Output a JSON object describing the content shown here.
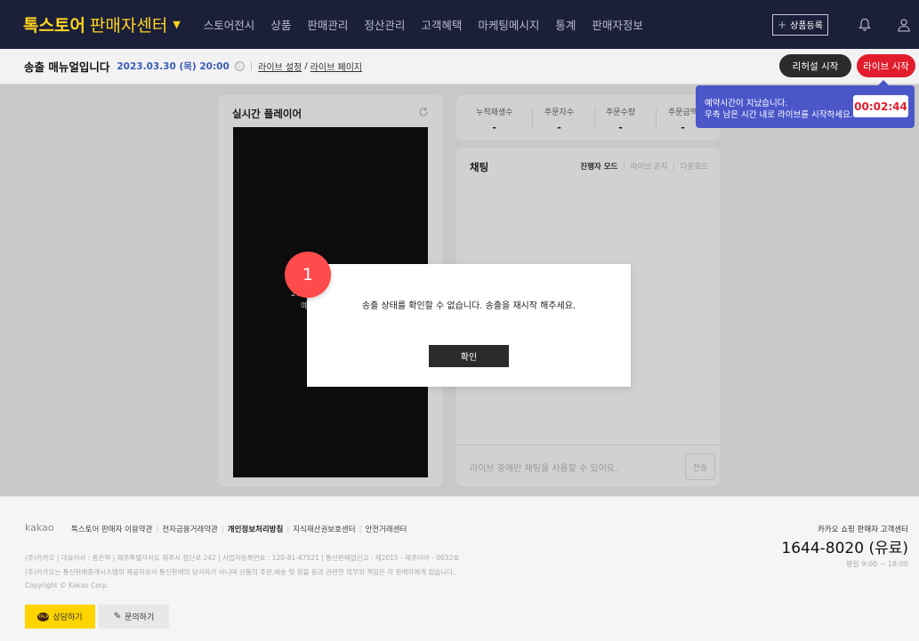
{
  "nav": {
    "brand_main": "톡스토어",
    "brand_sub": "판매자센터",
    "brand_caret": "▼",
    "menu": [
      "스토어전시",
      "상품",
      "판매관리",
      "정산관리",
      "고객혜택",
      "마케팅메시지",
      "통계",
      "판매자정보"
    ],
    "register_label": "상품등록",
    "register_icon": "plus-icon",
    "icons": [
      "bell-icon",
      "user-icon"
    ]
  },
  "subheader": {
    "title": "송출 매뉴얼입니다",
    "date": "2023.03.30 (목) 20:00",
    "info_icon": "ⓘ",
    "link_settings": "라이브 설정",
    "slash": "/",
    "link_page": "라이브 페이지",
    "rehearsal_button": "리허설 시작",
    "live_button": "라이브 시작"
  },
  "player": {
    "title": "실시간 플레이어",
    "refresh_icon": "refresh-icon",
    "video_text_1": "202",
    "video_text_2": "예"
  },
  "stats": [
    {
      "label": "누적재생수",
      "value": "-"
    },
    {
      "label": "주문자수",
      "value": "-"
    },
    {
      "label": "주문수량",
      "value": "-"
    },
    {
      "label": "주문금액",
      "value": "-"
    }
  ],
  "chat": {
    "title": "채팅",
    "mode_active": "진행자 모드",
    "mode_notice": "라이브 공지",
    "mode_download": "다운로드",
    "sep": "|",
    "placeholder": "라이브 중에만 채팅을 사용할 수 있어요.",
    "send_label": "전송"
  },
  "tooltip": {
    "line1": "예약시간이 지났습니다.",
    "line2": "우측 남은 시간 내로 라이브를 시작하세요.",
    "timer": "00:02:44",
    "accent": "#4b57c9"
  },
  "modal": {
    "message": "송출 상태를 확인할 수 없습니다. 송출을 재시작 해주세요.",
    "ok_label": "확인",
    "step_badge": "1"
  },
  "footer": {
    "logo": "kakao",
    "links": [
      {
        "text": "톡스토어 판매자 이용약관",
        "bold": false
      },
      {
        "text": "전자금융거래약관",
        "bold": false
      },
      {
        "text": "개인정보처리방침",
        "bold": true
      },
      {
        "text": "지식재산권보호센터",
        "bold": false
      },
      {
        "text": "안전거래센터",
        "bold": false
      }
    ],
    "company_line": "(주)카카오 | 대표이사 : 홍은택 | 제주특별자치도 제주시 첨단로 242 | 사업자등록번호 : 120-81-47521 | 통신판매업신고 : 제2015 - 제주아라 - 0032호",
    "disclaimer": "(주)카카오는 통신판매중개시스템의 제공자로서 통신판매의 당사자가 아니며 상품의 주문,배송 및 환불 등과 관련한 의무와 책임은 각 판매자에게 있습니다.",
    "copyright": "Copyright © Kakao Corp.",
    "cs_name": "카카오 쇼핑 판매자 고객센터",
    "cs_phone": "1644-8020 (유료)",
    "cs_hours": "평일 9:00 ~ 18:00",
    "talk_button": "상담하기",
    "talk_icon_text": "TALK",
    "inquiry_button": "문의하기"
  },
  "colors": {
    "nav_bg": "#1b1f3a",
    "brand": "#ffd51f",
    "live_red": "#e11d2d",
    "kakao_yellow": "#ffd400"
  }
}
